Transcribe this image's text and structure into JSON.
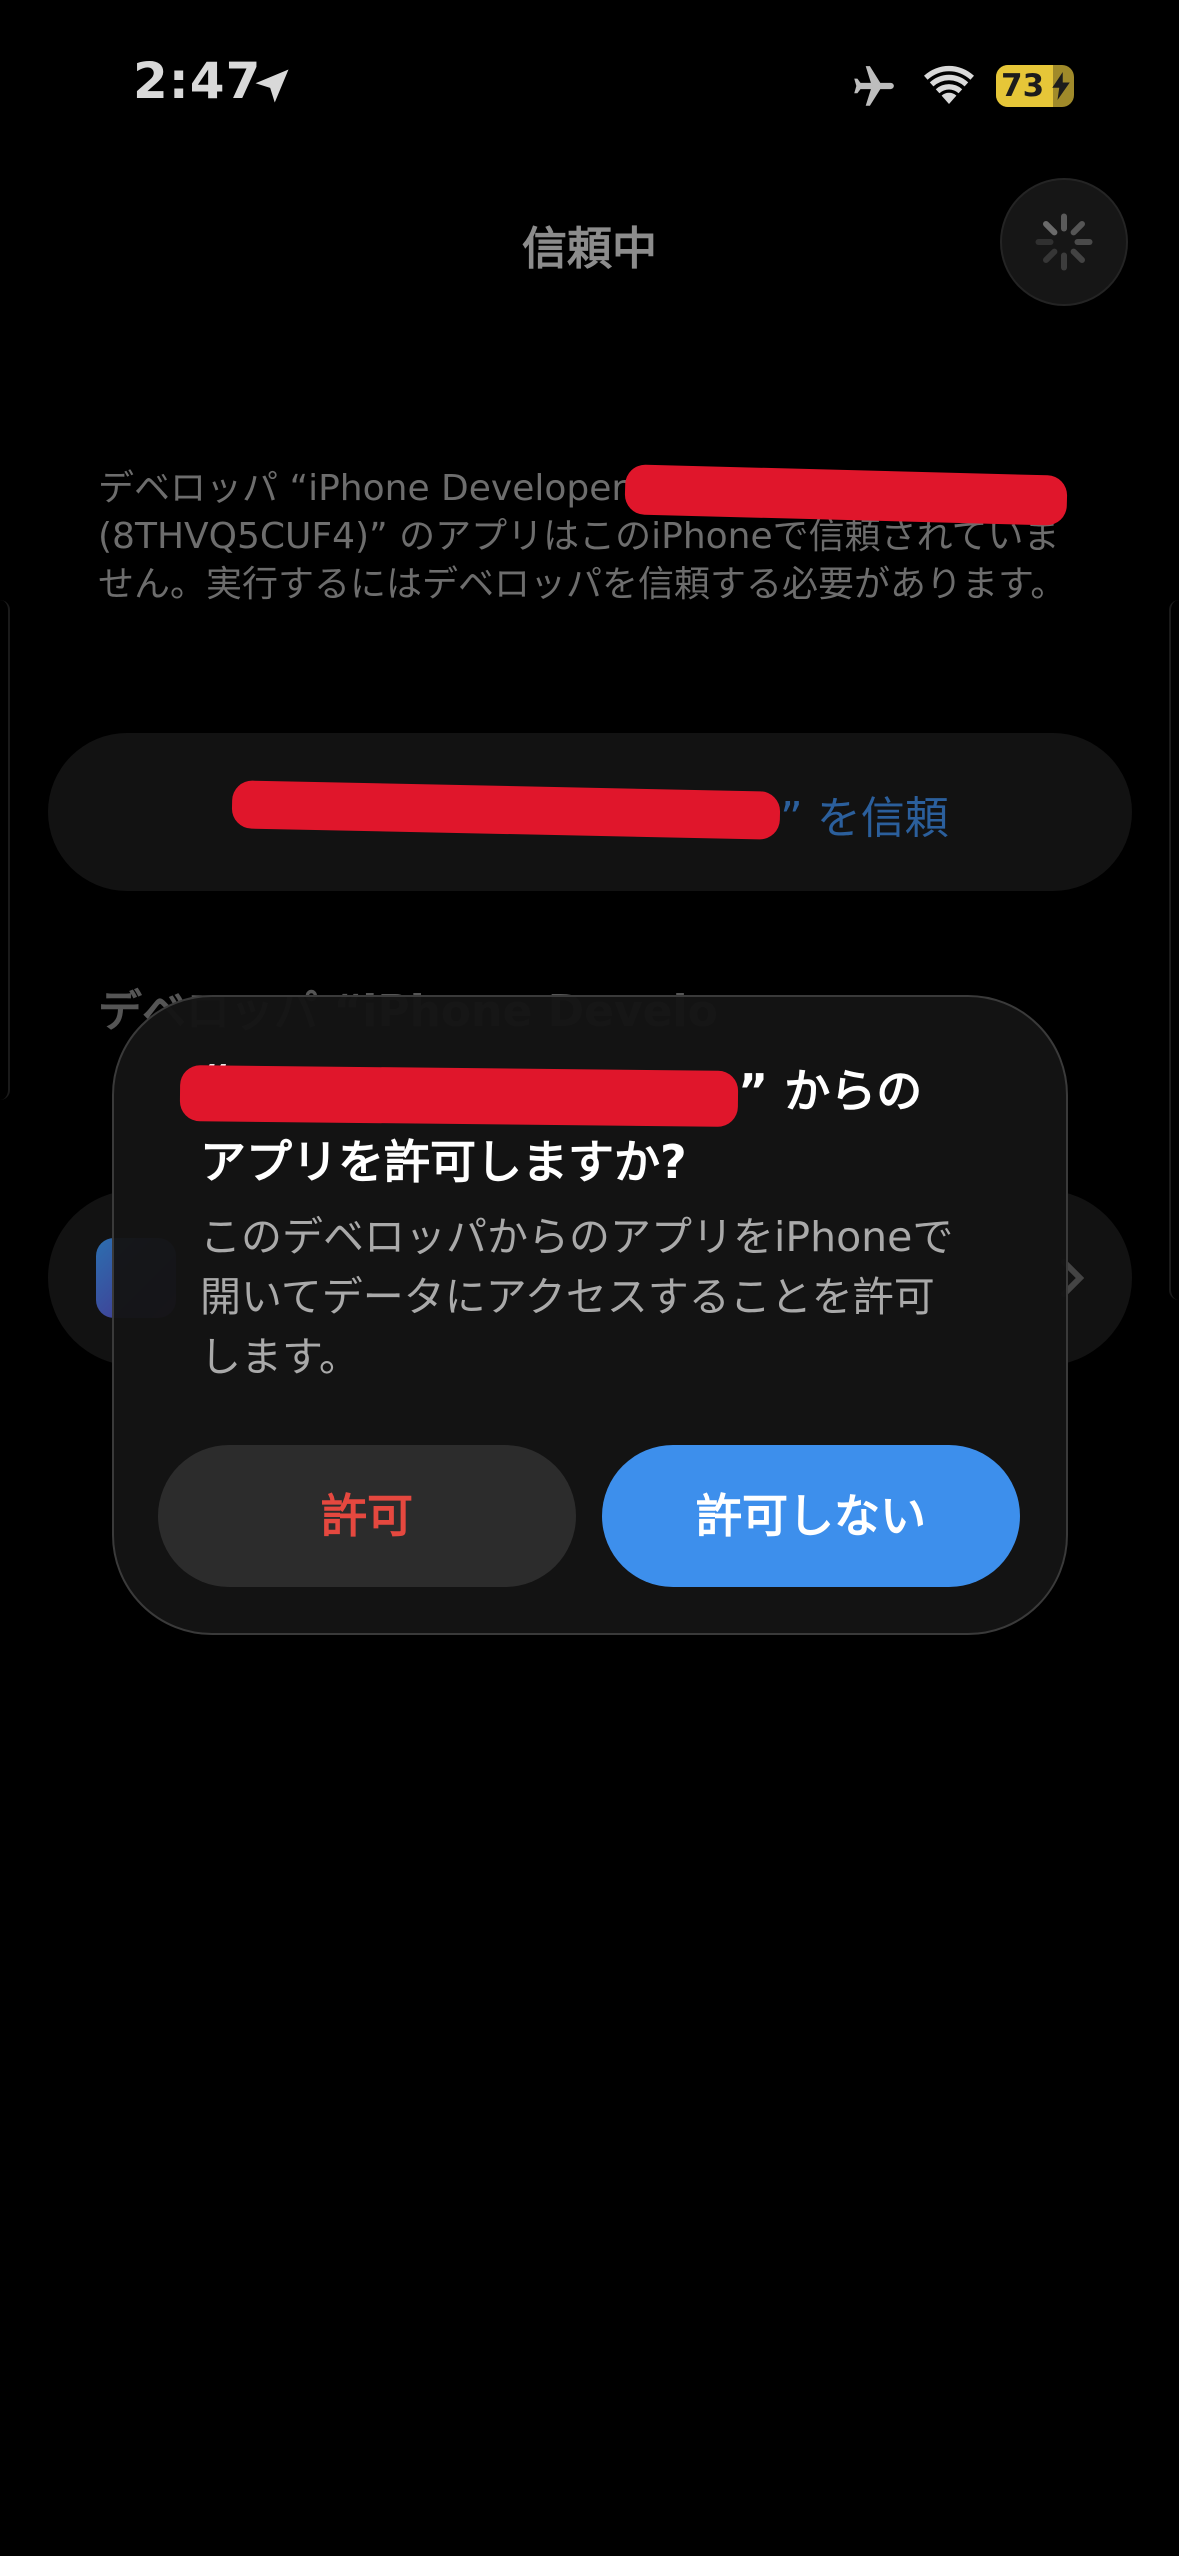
{
  "status_bar": {
    "time": "2:47",
    "battery_level": "73",
    "battery_fraction": 0.73,
    "location_icon": "location-arrow-icon",
    "airplane_icon": "airplane-icon",
    "wifi_icon": "wifi-icon",
    "battery_bolt_icon": "bolt-icon"
  },
  "page": {
    "title": "信頼中",
    "spinner_icon": "activity-spinner-icon",
    "developer_info_prefix": "デベロッパ “iPhone Developer: ",
    "developer_info_suffix": "(8THVQ5CUF4)” のアプリはこのiPhoneで信頼されていません。実行するにはデベロッパを信頼する必要があります。",
    "trust_button_label": "” を信頼",
    "section_heading": "デベロッパ “iPhone Develo",
    "chevron_icon": "chevron-right-icon"
  },
  "dialog": {
    "title_open_quote": "“",
    "title_line1_suffix": "” からの",
    "title_line2": "アプリを許可しますか?",
    "message": "このデベロッパからのアプリをiPhoneで開いてデータにアクセスすることを許可します。",
    "allow_label": "許可",
    "deny_label": "許可しない"
  },
  "colors": {
    "redaction": "#e0162b",
    "allow_text": "#e5483f",
    "deny_bg": "#3d8fec",
    "link_blue": "#2b5f9c"
  }
}
